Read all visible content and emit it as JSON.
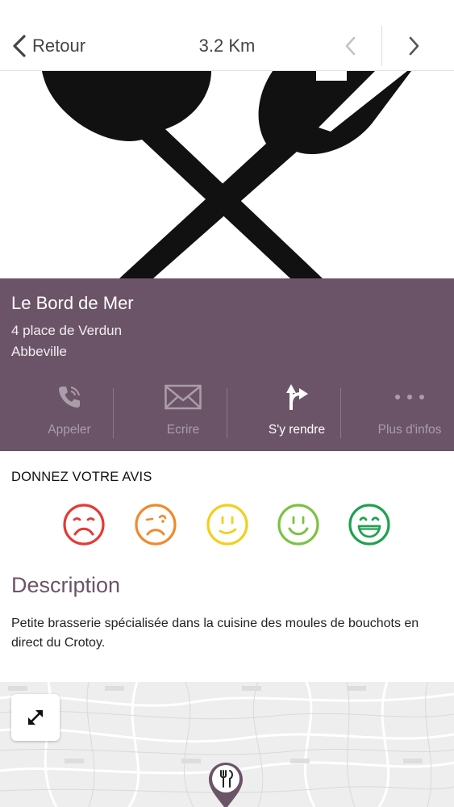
{
  "header": {
    "back_label": "Retour",
    "distance": "3.2 Km"
  },
  "place": {
    "name": "Le Bord de Mer",
    "address_line1": "4 place de Verdun",
    "address_line2": "Abbeville"
  },
  "actions": [
    {
      "label": "Appeler",
      "icon": "phone-icon",
      "active": false
    },
    {
      "label": "Ecrire",
      "icon": "envelope-icon",
      "active": false
    },
    {
      "label": "S'y rendre",
      "icon": "directions-icon",
      "active": true
    },
    {
      "label": "Plus d'infos",
      "icon": "more-icon",
      "active": false
    }
  ],
  "rating": {
    "title": "DONNEZ VOTRE AVIS",
    "smileys": [
      {
        "icon": "very-sad-face-icon",
        "color": "#e53935"
      },
      {
        "icon": "sad-face-icon",
        "color": "#f08a2a"
      },
      {
        "icon": "neutral-face-icon",
        "color": "#f2cf1d"
      },
      {
        "icon": "happy-face-icon",
        "color": "#7cc242"
      },
      {
        "icon": "very-happy-face-icon",
        "color": "#1ea150"
      }
    ]
  },
  "description": {
    "title": "Description",
    "text": "Petite brasserie spécialisée dans la cuisine des moules de bouchots en direct du Crotoy."
  },
  "colors": {
    "panel": "#6b5468",
    "accent": "#6b5468"
  }
}
